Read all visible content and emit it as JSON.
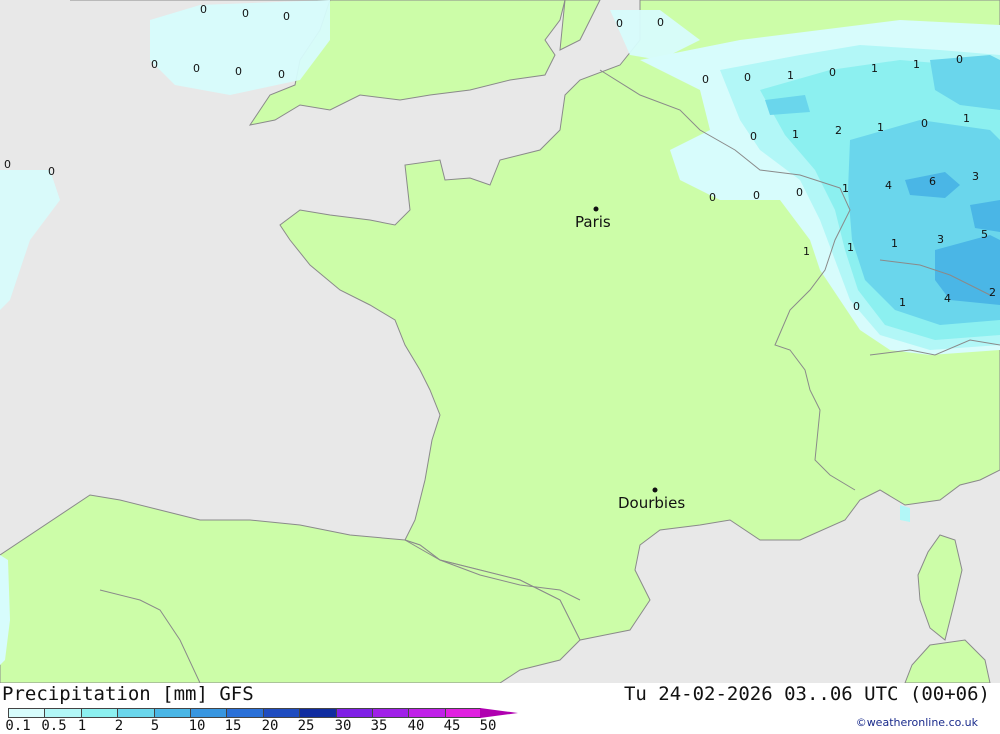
{
  "map": {
    "product_label": "Precipitation [mm] GFS",
    "valid_time": "Tu 24-02-2026 03..06 UTC (00+06)",
    "credit": "©weatheronline.co.uk",
    "land_color": "#ccfda8",
    "sea_color": "#e8e8e8",
    "cities": [
      {
        "name": "Paris"
      },
      {
        "name": "Dourbies"
      }
    ],
    "values": [
      "0",
      "0",
      "0",
      "0",
      "0",
      "0",
      "0",
      "0",
      "0",
      "0",
      "0",
      "0",
      "0",
      "0",
      "1",
      "0",
      "1",
      "1",
      "0",
      "0",
      "1",
      "2",
      "1",
      "0",
      "1",
      "0",
      "0",
      "1",
      "4",
      "6",
      "3",
      "1",
      "1",
      "1",
      "3",
      "5",
      "0",
      "1",
      "4",
      "2"
    ]
  },
  "legend": {
    "ticks": [
      "0.1",
      "0.5",
      "1",
      "2",
      "5",
      "10",
      "15",
      "20",
      "25",
      "30",
      "35",
      "40",
      "45",
      "50"
    ],
    "colors": [
      "#d7fcfc",
      "#b2f7f7",
      "#8cf0f0",
      "#6ad6ec",
      "#4ab6e6",
      "#3896e0",
      "#2a70d8",
      "#1f4cc0",
      "#102ca0",
      "#7f20e6",
      "#a020e8",
      "#c020e8",
      "#e020e0",
      "#b800b0"
    ]
  }
}
